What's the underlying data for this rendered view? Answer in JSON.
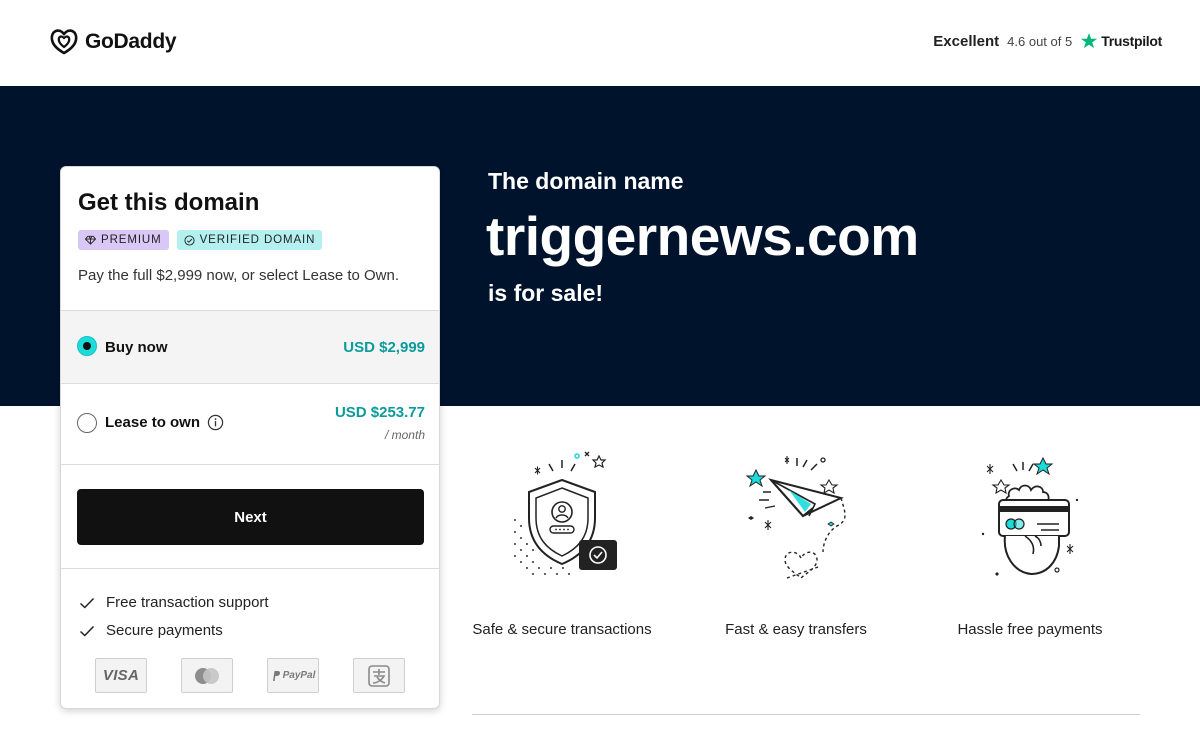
{
  "header": {
    "logo_text": "GoDaddy",
    "trust_rating": "Excellent",
    "trust_score": "4.6 out of 5",
    "trust_brand": "Trustpilot"
  },
  "hero": {
    "kicker": "The domain name",
    "domain": "triggernews.com",
    "suffix": "is for sale!"
  },
  "card": {
    "title": "Get this domain",
    "badges": [
      "PREMIUM",
      "VERIFIED DOMAIN"
    ],
    "subtitle": "Pay the full $2,999 now, or select Lease to Own.",
    "options": [
      {
        "label": "Buy now",
        "price": "USD $2,999",
        "selected": true
      },
      {
        "label": "Lease to own",
        "price": "USD $253.77",
        "period": "/ month",
        "selected": false
      }
    ],
    "next_label": "Next",
    "features": [
      "Free transaction support",
      "Secure payments"
    ],
    "payment_methods": [
      "visa-icon",
      "mastercard-icon",
      "paypal-icon",
      "alipay-icon"
    ],
    "payment_texts": {
      "visa": "VISA",
      "paypal": "PayPal"
    }
  },
  "benefits": [
    {
      "icon": "shield-icon",
      "label": "Safe & secure transactions"
    },
    {
      "icon": "paper-plane-icon",
      "label": "Fast & easy transfers"
    },
    {
      "icon": "payment-card-icon",
      "label": "Hassle free payments"
    }
  ],
  "colors": {
    "hero_bg": "#00132d",
    "accent_teal": "#1bdbdb",
    "price_teal": "#0b9b9b",
    "premium_badge": "#d9c7f5",
    "verified_badge": "#b5f0f0",
    "trustpilot_green": "#00b67a",
    "button_bg": "#111111"
  }
}
